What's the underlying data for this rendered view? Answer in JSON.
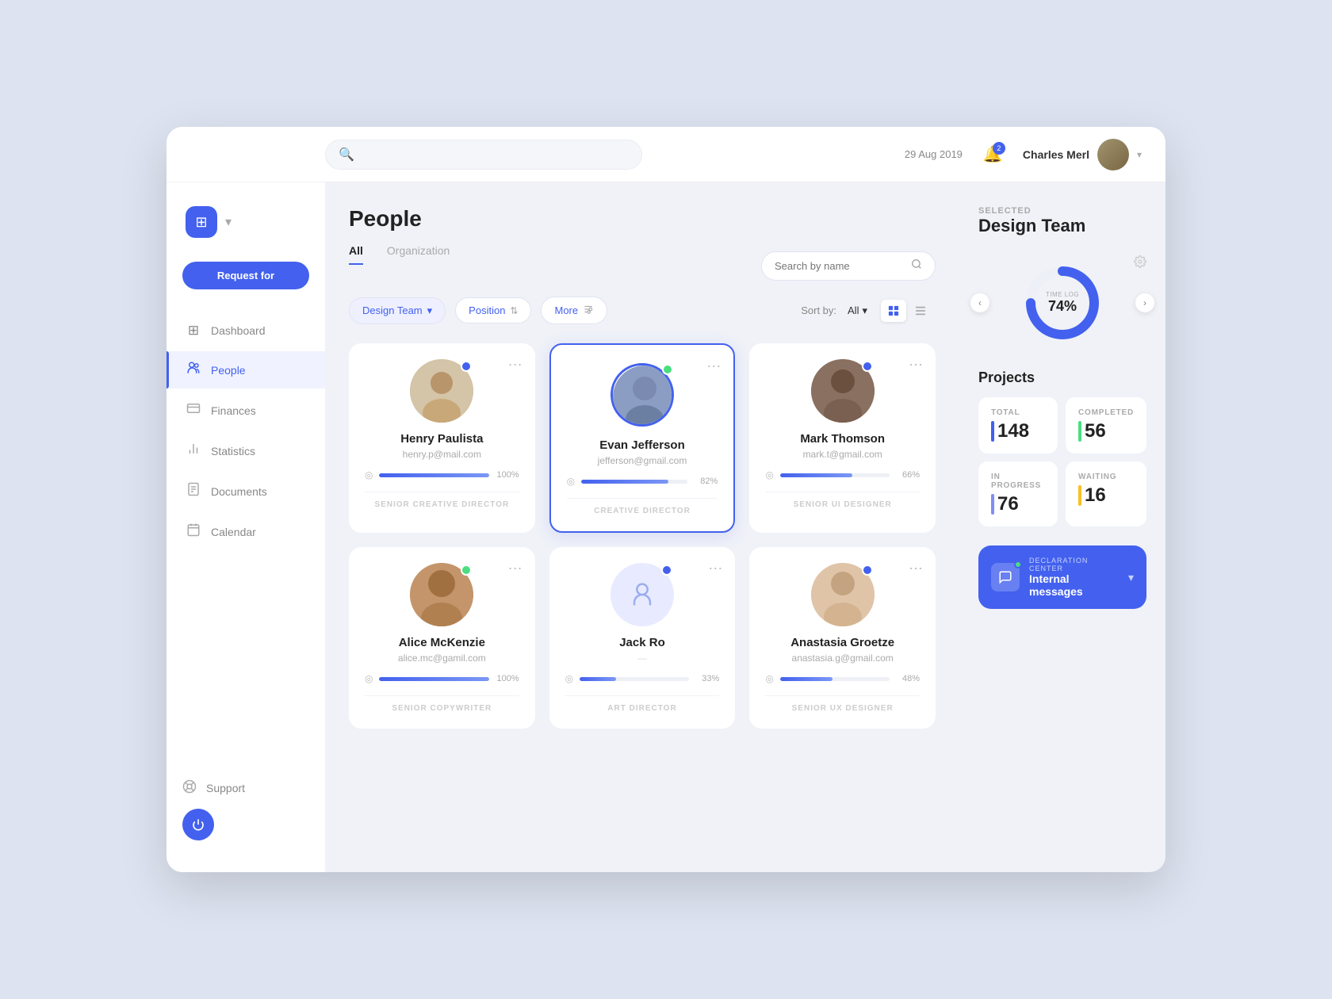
{
  "app": {
    "logo_icon": "⊞",
    "date": "29 Aug 2019",
    "notification_count": "2",
    "user_name": "Charles Merl",
    "chevron": "▾"
  },
  "sidebar": {
    "request_btn": "Request for",
    "items": [
      {
        "id": "dashboard",
        "label": "Dashboard",
        "icon": "▦"
      },
      {
        "id": "people",
        "label": "People",
        "icon": "👥",
        "active": true
      },
      {
        "id": "finances",
        "label": "Finances",
        "icon": "💳"
      },
      {
        "id": "statistics",
        "label": "Statistics",
        "icon": "📊"
      },
      {
        "id": "documents",
        "label": "Documents",
        "icon": "📄"
      },
      {
        "id": "calendar",
        "label": "Calendar",
        "icon": "📅"
      }
    ],
    "support_label": "Support",
    "support_icon": "⚙",
    "power_icon": "⏻"
  },
  "content": {
    "page_title": "People",
    "tabs": [
      {
        "id": "all",
        "label": "All",
        "active": true
      },
      {
        "id": "organization",
        "label": "Organization",
        "active": false
      }
    ],
    "search_placeholder": "Search by name",
    "filters": {
      "team_label": "Design Team",
      "position_label": "Position",
      "more_label": "More",
      "sort_label": "Sort by:",
      "sort_value": "All"
    },
    "people": [
      {
        "id": "henry",
        "name": "Henry Paulista",
        "email": "henry.p@mail.com",
        "progress": 100,
        "role": "SENIOR CREATIVE DIRECTOR",
        "status_color": "blue",
        "selected": false
      },
      {
        "id": "evan",
        "name": "Evan Jefferson",
        "email": "jefferson@gmail.com",
        "progress": 82,
        "role": "CREATIVE DIRECTOR",
        "status_color": "online",
        "selected": true
      },
      {
        "id": "mark",
        "name": "Mark Thomson",
        "email": "mark.t@gmail.com",
        "progress": 66,
        "role": "SENIOR UI DESIGNER",
        "status_color": "blue",
        "selected": false
      },
      {
        "id": "alice",
        "name": "Alice McKenzie",
        "email": "alice.mc@gamil.com",
        "progress": 100,
        "role": "SENIOR COPYWRITER",
        "status_color": "online",
        "selected": false
      },
      {
        "id": "jack",
        "name": "Jack Ro",
        "email": "—",
        "progress": 33,
        "role": "ART DIRECTOR",
        "status_color": "blue",
        "selected": false,
        "placeholder": true
      },
      {
        "id": "anastasia",
        "name": "Anastasia Groetze",
        "email": "anastasia.g@gmail.com",
        "progress": 48,
        "role": "SENIOR UX DESIGNER",
        "status_color": "blue",
        "selected": false
      }
    ]
  },
  "right_panel": {
    "selected_label": "SELECTED",
    "team_name": "Design Team",
    "time_log": {
      "label": "TIME LOG",
      "percent": 74,
      "display": "74%"
    },
    "projects_title": "Projects",
    "stats": [
      {
        "id": "total",
        "label": "TOTAL",
        "value": "148",
        "bar_color": "blue"
      },
      {
        "id": "completed",
        "label": "COMPLETED",
        "value": "56",
        "bar_color": "green"
      },
      {
        "id": "in_progress",
        "label": "IN PROGRESS",
        "value": "76",
        "bar_color": "indigo"
      },
      {
        "id": "waiting",
        "label": "WAITING",
        "value": "16",
        "bar_color": "yellow"
      }
    ],
    "declaration": {
      "label": "DECLARATION CENTER",
      "title": "Internal messages",
      "arrow": "▾"
    }
  }
}
